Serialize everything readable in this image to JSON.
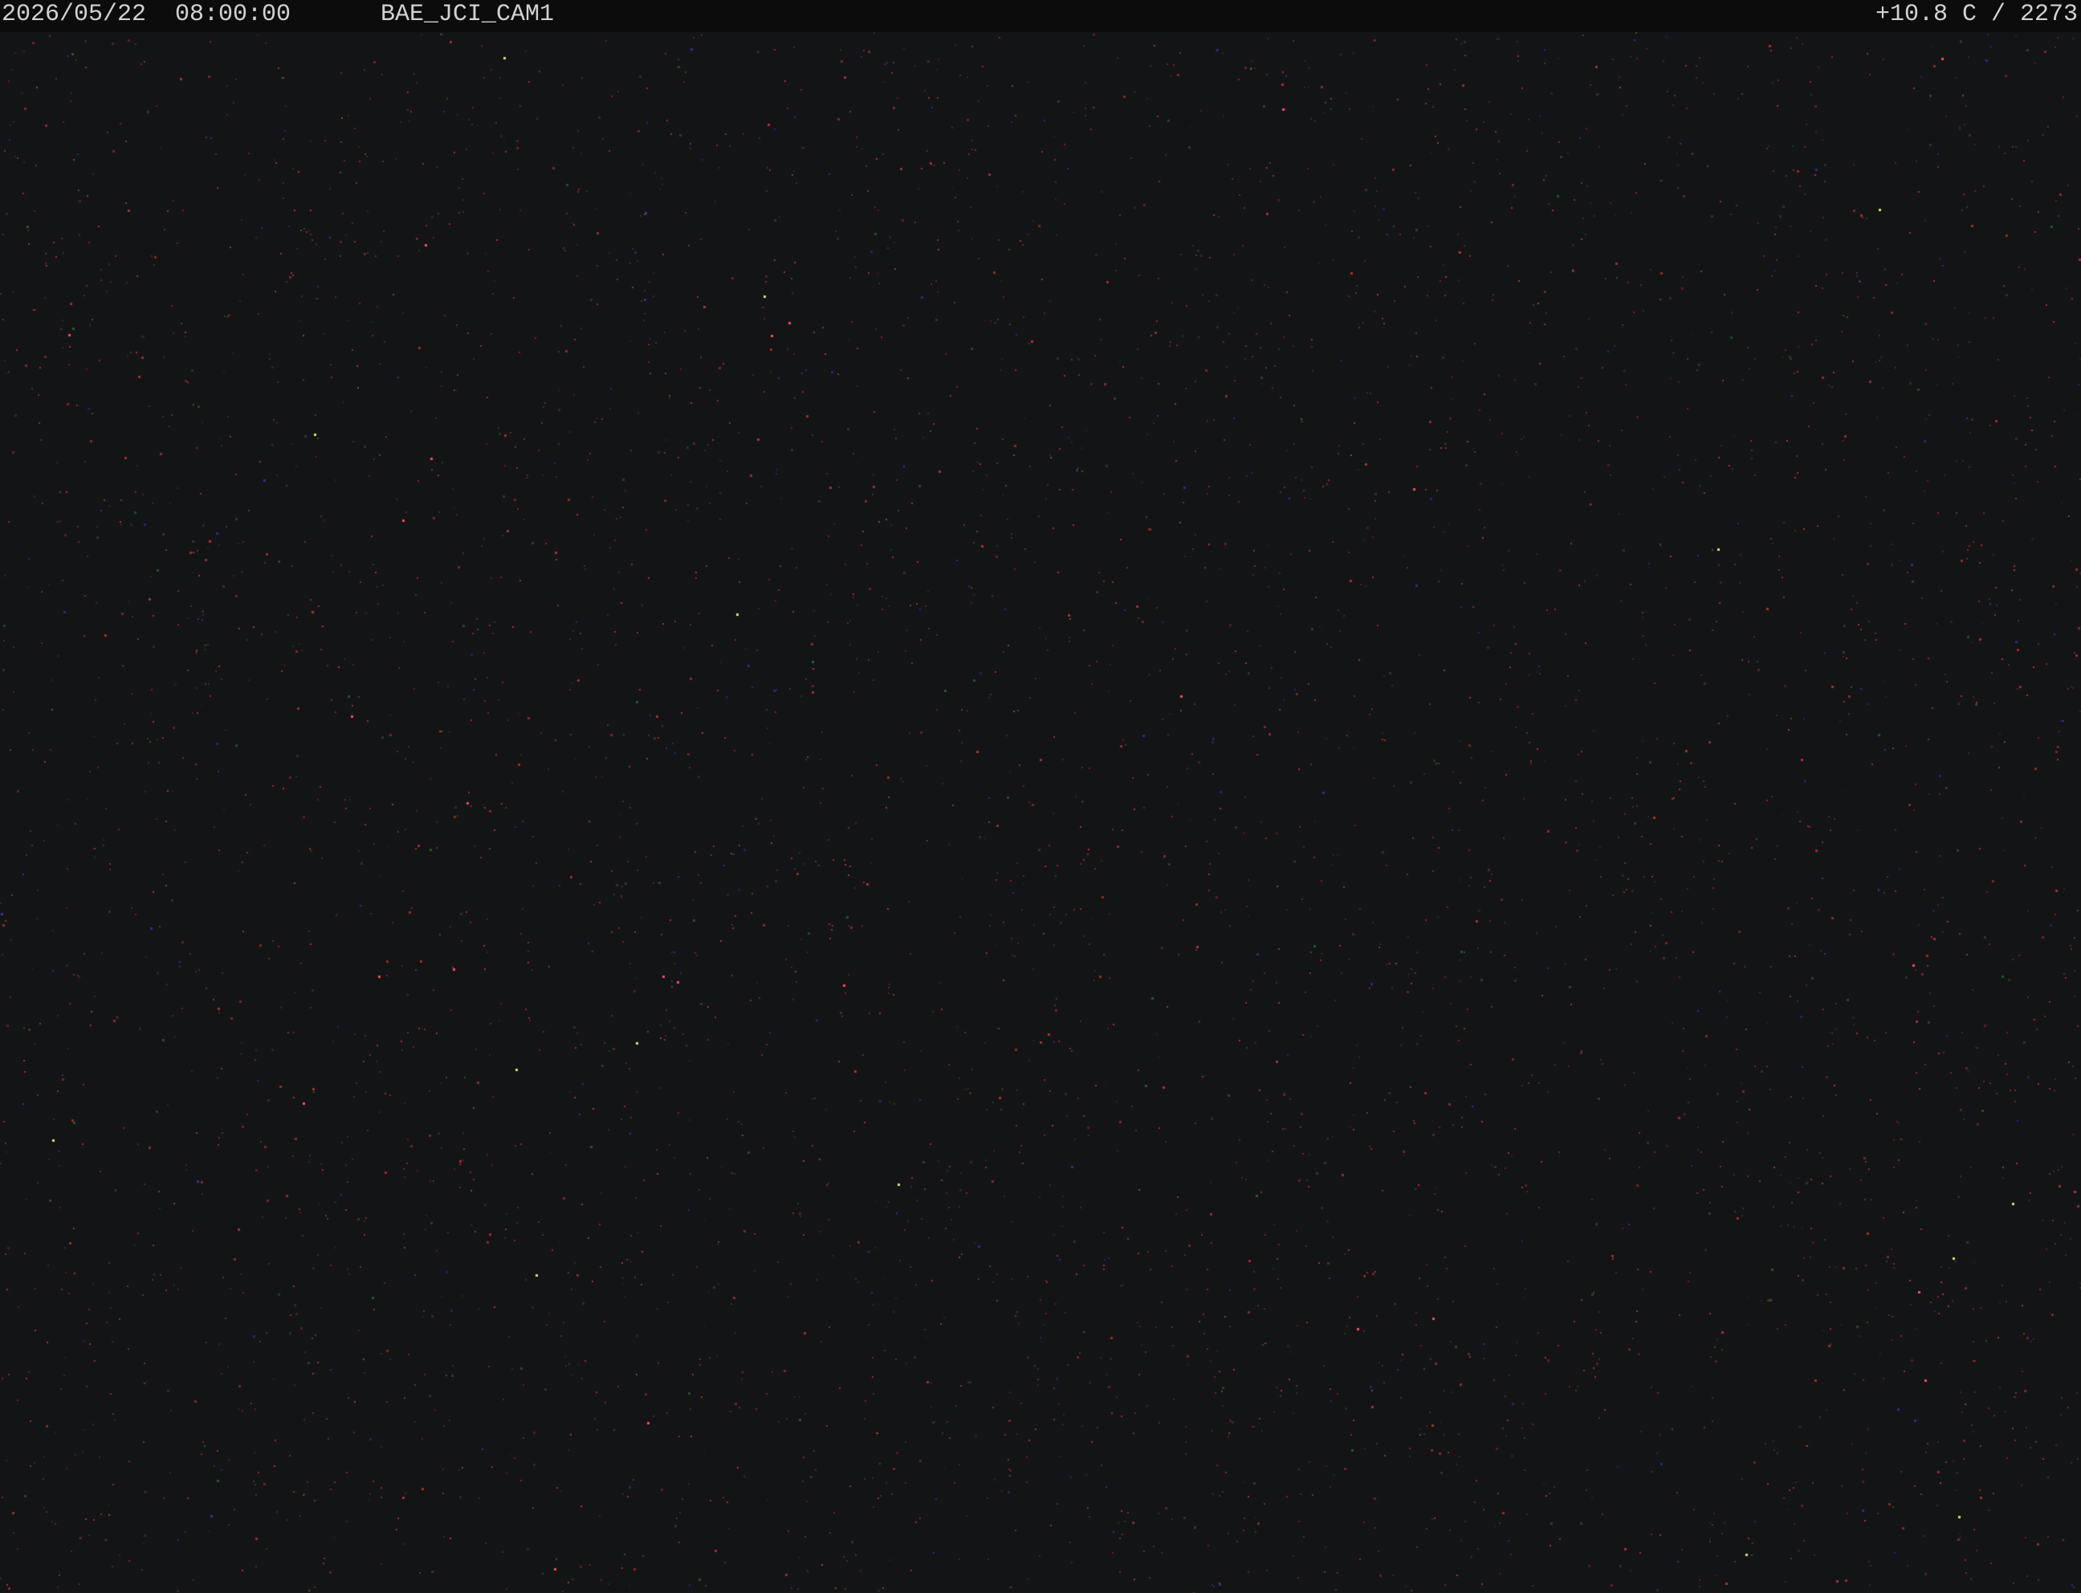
{
  "overlay": {
    "timestamp": "2026/05/22  08:00:00",
    "camera_name": "BAE_JCI_CAM1",
    "sensor_readout": "+10.8 C / 2273"
  },
  "colors": {
    "background": "#131415",
    "overlay_bar": "#0c0c0c",
    "overlay_text": "#d2d2d2",
    "noise_red": "#c8323c",
    "noise_green": "#3c8c46",
    "noise_blue": "#3c3cc8",
    "noise_grey": "#4a4a4a"
  }
}
